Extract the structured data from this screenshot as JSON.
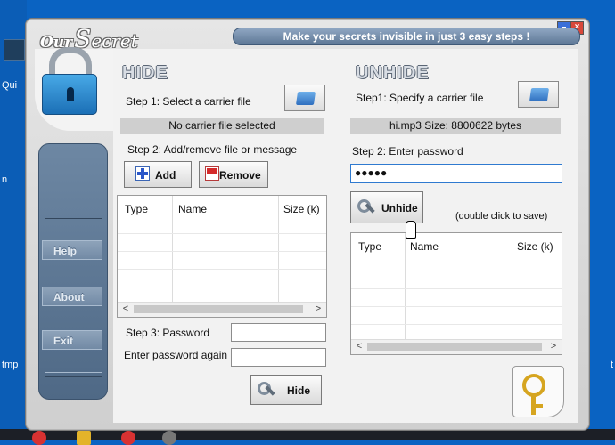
{
  "desktop": {
    "left_labels": [
      "Qui",
      "n",
      "tmp"
    ],
    "right_labels": [
      "t"
    ]
  },
  "window": {
    "minimize_glyph": "–",
    "close_glyph": "×"
  },
  "logo": {
    "part1": "Our",
    "part2": "S",
    "part3": "ecret"
  },
  "banner": "Make your secrets invisible in just 3 easy steps !",
  "sidebar": {
    "help": "Help",
    "about": "About",
    "exit": "Exit"
  },
  "hide": {
    "title": "HIDE",
    "step1": "Step 1: Select a carrier file",
    "carrier_status": "No carrier file selected",
    "step2": "Step 2: Add/remove file or message",
    "add_label": "Add",
    "remove_label": "Remove",
    "columns": [
      "Type",
      "Name",
      "Size (k)"
    ],
    "step3": "Step 3: Password",
    "password_again": "Enter password again",
    "password_value": "",
    "password_again_value": "",
    "hide_label": "Hide"
  },
  "unhide": {
    "title": "UNHIDE",
    "step1": "Step1: Specify a carrier file",
    "carrier_status": "hi.mp3   Size: 8800622 bytes",
    "step2": "Step 2: Enter password",
    "password_value": "●●●●●",
    "unhide_label": "Unhide",
    "hint": "(double click to save)",
    "columns": [
      "Type",
      "Name",
      "Size (k)"
    ]
  },
  "scroll": {
    "left": "<",
    "right": ">"
  }
}
